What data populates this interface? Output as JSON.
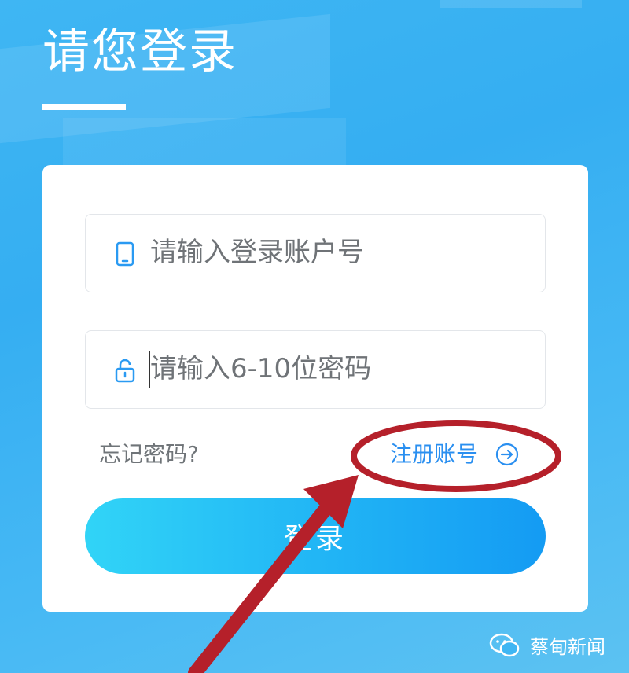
{
  "header": {
    "title": "请您登录"
  },
  "login_form": {
    "account_placeholder": "请输入登录账户号",
    "password_placeholder": "请输入6-10位密码",
    "forgot_password_label": "忘记密码?",
    "register_label": "注册账号",
    "login_button_label": "登录"
  },
  "watermark": {
    "source_label": "蔡甸新闻"
  },
  "icons": {
    "account_field": "phone-icon",
    "password_field": "lock-icon",
    "register_link": "arrow-circle-right-icon",
    "watermark": "wechat-logo-icon"
  },
  "colors": {
    "background": "#3fb6f3",
    "card": "#ffffff",
    "accent_link": "#2a8ff0",
    "button_gradient_start": "#31d4f7",
    "button_gradient_end": "#149bf3",
    "annotation_red": "#b5202a"
  }
}
